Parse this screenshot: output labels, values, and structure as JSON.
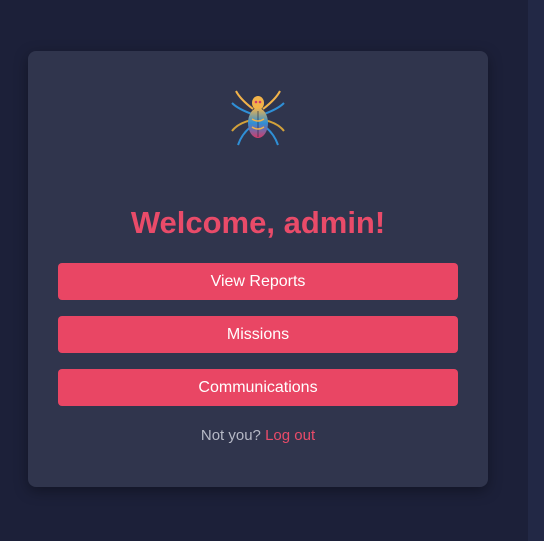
{
  "welcome": {
    "heading": "Welcome, admin!"
  },
  "logo": {
    "icon": "spider-icon"
  },
  "actions": {
    "view_reports": "View Reports",
    "missions": "Missions",
    "communications": "Communications"
  },
  "footer": {
    "prompt": "Not you?",
    "logout_link": "Log out"
  },
  "colors": {
    "page_background": "#1c2039",
    "card_background": "#30354d",
    "accent": "#e94664",
    "muted_text": "#b6b9c6"
  }
}
